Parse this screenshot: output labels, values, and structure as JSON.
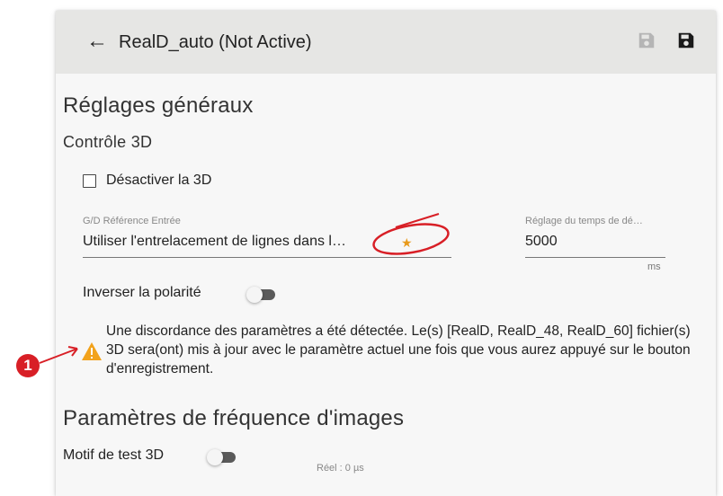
{
  "header": {
    "back_icon": "arrow-left-icon",
    "title": "RealD_auto (Not Active)",
    "save_disabled_icon": "save-icon",
    "save_icon": "save-icon"
  },
  "general": {
    "section_title": "Réglages généraux",
    "control_title": "Contrôle 3D",
    "disable_3d_label": "Désactiver la 3D",
    "disable_3d_checked": false,
    "gd_ref_label": "G/D Référence Entrée",
    "gd_ref_value": "Utiliser l'entrelacement de lignes dans l…",
    "gd_ref_marker": "★",
    "timing_label": "Réglage du temps de dé…",
    "timing_value": "5000",
    "timing_unit": "ms",
    "invert_polarity_label": "Inverser la polarité",
    "invert_polarity_on": false,
    "warning_icon": "warning-triangle-icon",
    "warning_text": "Une discordance des paramètres a été détectée. Le(s) [RealD, RealD_48, RealD_60] fichier(s) 3D sera(ont) mis à jour avec le paramètre actuel une fois que vous aurez appuyé sur le bouton d'enregistrement."
  },
  "frame_rate": {
    "section_title": "Paramètres de fréquence d'images",
    "test_pattern_label": "Motif de test 3D",
    "test_pattern_on": false,
    "real_status": "Réel : 0 µs"
  },
  "annotation": {
    "badge_label": "1",
    "color": "#d81f26"
  }
}
